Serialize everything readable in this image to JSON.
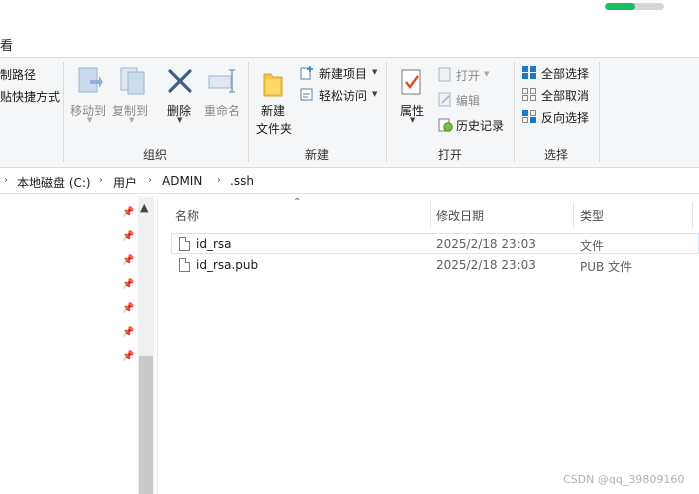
{
  "window": {
    "progress_fraction": 0.5,
    "progress_color": "#16c060"
  },
  "menu": {
    "view_tab_fragment": "看"
  },
  "ribbon": {
    "clipboard_partial": {
      "copy_path_fragment": "制路径",
      "paste_shortcut_fragment": "贴快捷方式"
    },
    "organize": {
      "label": "组织",
      "move_to": "移动到",
      "copy_to": "复制到",
      "delete": "删除",
      "rename": "重命名"
    },
    "new": {
      "label": "新建",
      "new_folder_line1": "新建",
      "new_folder_line2": "文件夹",
      "new_item": "新建项目",
      "easy_access": "轻松访问"
    },
    "open": {
      "label": "打开",
      "properties": "属性",
      "open": "打开",
      "edit": "编辑",
      "history": "历史记录"
    },
    "select": {
      "label": "选择",
      "select_all": "全部选择",
      "select_none": "全部取消",
      "invert_selection": "反向选择"
    }
  },
  "address": {
    "crumbs": [
      "本地磁盘 (C:)",
      "用户",
      "ADMIN",
      ".ssh"
    ]
  },
  "file_list": {
    "columns": {
      "name": "名称",
      "date": "修改日期",
      "type": "类型"
    },
    "rows": [
      {
        "name": "id_rsa",
        "date": "2025/2/18 23:03",
        "type": "文件"
      },
      {
        "name": "id_rsa.pub",
        "date": "2025/2/18 23:03",
        "type": "PUB 文件"
      }
    ]
  },
  "watermark": "CSDN @qq_39809160",
  "colors": {
    "accent": "#1979ca",
    "selection_border": "#cde8ff",
    "window_bg": "#f5f6f7"
  }
}
